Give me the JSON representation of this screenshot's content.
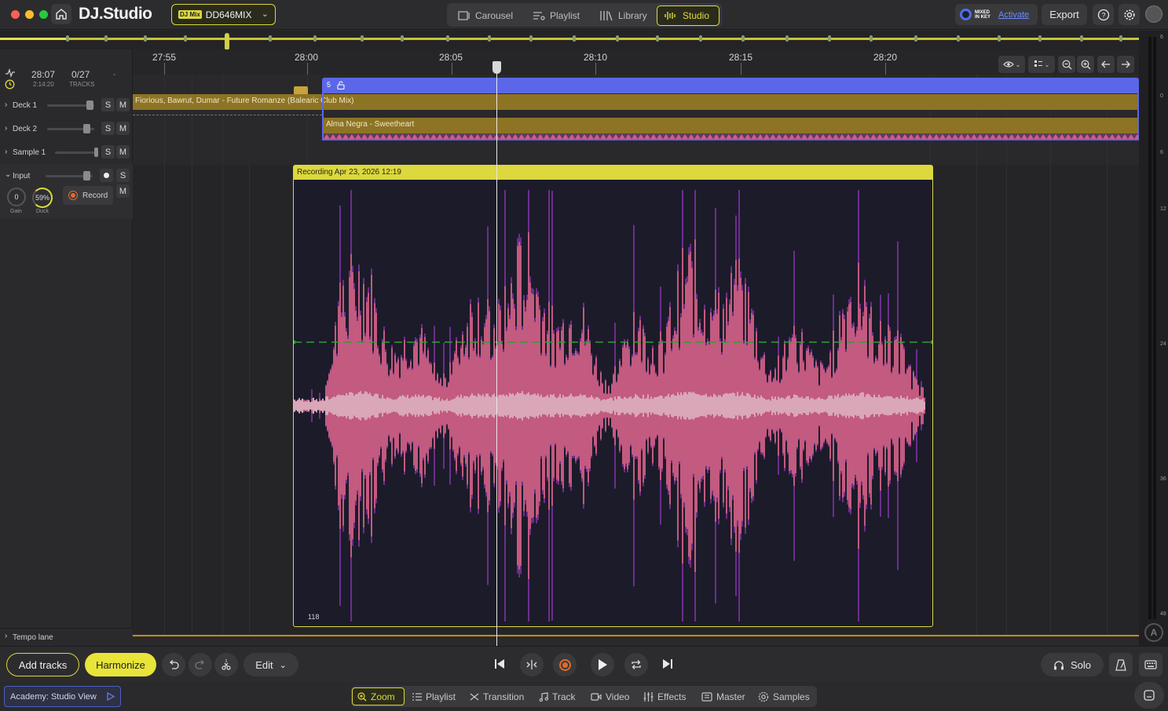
{
  "app": {
    "logo_text": "DJ.Studio",
    "mix_badge": "DJ Mix",
    "mix_name": "DD646MIX"
  },
  "nav": {
    "tabs": [
      {
        "label": "Carousel",
        "icon": "carousel-icon"
      },
      {
        "label": "Playlist",
        "icon": "playlist-icon"
      },
      {
        "label": "Library",
        "icon": "library-icon"
      },
      {
        "label": "Studio",
        "icon": "waveform-icon",
        "active": true
      }
    ]
  },
  "header_right": {
    "brand": "MIXED IN KEY",
    "activate": "Activate",
    "export": "Export"
  },
  "stats": {
    "duration": "28:07",
    "sub_duration": "2:14:20",
    "tracks": "0/27",
    "tracks_label": "TRACKS",
    "dash": "-"
  },
  "ruler": {
    "labels": [
      "27:55",
      "28:00",
      "28:05",
      "28:10",
      "28:15",
      "28:20"
    ]
  },
  "lanes": {
    "deck1": "Deck 1",
    "deck2": "Deck 2",
    "sample1": "Sample 1",
    "input": "Input",
    "gain_value": "0",
    "gain_label": "Gain",
    "duck_value": "59%",
    "duck_label": "Duck",
    "record": "Record",
    "solo": "S",
    "mute": "M",
    "tempo_lane": "Tempo lane"
  },
  "clips": {
    "transition_number": "5",
    "deck1_track": "Fiorious, Bawrut, Dumar - Future Romanze (Balearic Club Mix)",
    "deck2_track": "Alma Negra - Sweetheart",
    "recording_title": "Recording Apr 23, 2026 12:19",
    "bpm": "118"
  },
  "meter": {
    "labels": [
      "6",
      "0",
      "6",
      "12",
      "24",
      "36",
      "48"
    ]
  },
  "transport": {
    "add_tracks": "Add tracks",
    "harmonize": "Harmonize",
    "edit": "Edit",
    "solo": "Solo"
  },
  "bottom": {
    "academy": "Academy: Studio View",
    "tabs": [
      {
        "label": "Zoom",
        "icon": "zoom-icon",
        "active": true
      },
      {
        "label": "Playlist",
        "icon": "list-icon"
      },
      {
        "label": "Transition",
        "icon": "transition-icon"
      },
      {
        "label": "Track",
        "icon": "music-note-icon"
      },
      {
        "label": "Video",
        "icon": "video-icon"
      },
      {
        "label": "Effects",
        "icon": "sliders-icon"
      },
      {
        "label": "Master",
        "icon": "master-icon"
      },
      {
        "label": "Samples",
        "icon": "samples-icon"
      }
    ]
  },
  "colors": {
    "accent": "#dcd83e",
    "deck_clip": "#8d7424",
    "transition": "#5b67e8",
    "waveform": "#c35a7f",
    "waveform_peak": "#6b2f8c",
    "automation_line": "#2fa02f"
  }
}
